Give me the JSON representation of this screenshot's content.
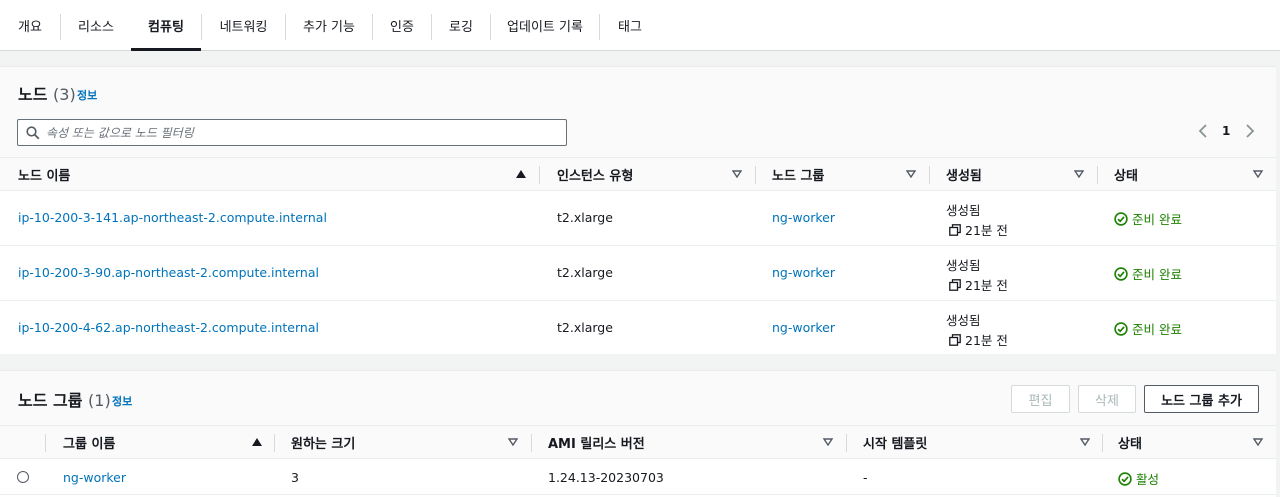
{
  "tabs": [
    {
      "label": "개요"
    },
    {
      "label": "리소스"
    },
    {
      "label": "컴퓨팅",
      "active": true
    },
    {
      "label": "네트워킹"
    },
    {
      "label": "추가 기능"
    },
    {
      "label": "인증"
    },
    {
      "label": "로깅"
    },
    {
      "label": "업데이트 기록"
    },
    {
      "label": "태그"
    }
  ],
  "nodes": {
    "title": "노드",
    "count": "(3)",
    "info": "정보",
    "search_placeholder": "속성 또는 값으로 노드 필터링",
    "page": "1",
    "columns": [
      "노드 이름",
      "인스턴스 유형",
      "노드 그룹",
      "생성됨",
      "상태"
    ],
    "rows": [
      {
        "name": "ip-10-200-3-141.ap-northeast-2.compute.internal",
        "instance_type": "t2.xlarge",
        "node_group": "ng-worker",
        "created_label": "생성됨",
        "created": "21분 전",
        "status": "준비 완료"
      },
      {
        "name": "ip-10-200-3-90.ap-northeast-2.compute.internal",
        "instance_type": "t2.xlarge",
        "node_group": "ng-worker",
        "created_label": "생성됨",
        "created": "21분 전",
        "status": "준비 완료"
      },
      {
        "name": "ip-10-200-4-62.ap-northeast-2.compute.internal",
        "instance_type": "t2.xlarge",
        "node_group": "ng-worker",
        "created_label": "생성됨",
        "created": "21분 전",
        "status": "준비 완료"
      }
    ]
  },
  "node_groups": {
    "title": "노드 그룹",
    "count": "(1)",
    "info": "정보",
    "edit_label": "편집",
    "delete_label": "삭제",
    "add_label": "노드 그룹 추가",
    "columns": [
      "그룹 이름",
      "원하는 크기",
      "AMI 릴리스 버전",
      "시작 템플릿",
      "상태"
    ],
    "rows": [
      {
        "name": "ng-worker",
        "desired_size": "3",
        "ami_version": "1.24.13-20230703",
        "launch_template": "-",
        "status": "활성"
      }
    ]
  },
  "colors": {
    "link": "#0073bb",
    "success": "#1d8102",
    "text": "#16191f"
  },
  "icons": {
    "search": "search-icon",
    "sort_asc": "sort-ascending-icon",
    "sort_desc": "sort-caret-down-icon",
    "copy": "copy-icon",
    "status_ok": "check-circle-icon",
    "prev": "chevron-left-icon",
    "next": "chevron-right-icon"
  }
}
